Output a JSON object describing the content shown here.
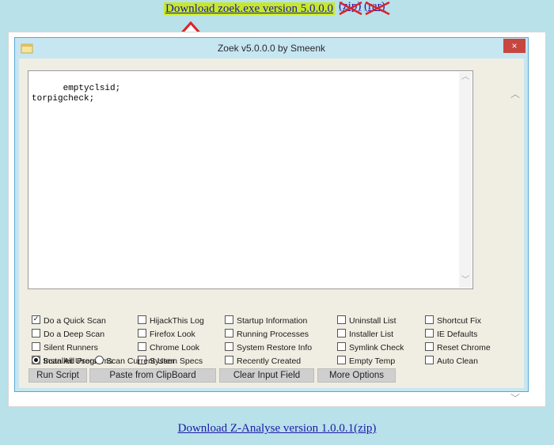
{
  "top_link": "Download zoek.exe version 5.0.0.0",
  "struck_links": [
    "(zip)",
    "(rar)"
  ],
  "bottom_link": "Download Z-Analyse version 1.0.0.1(zip)",
  "window": {
    "title": "Zoek v5.0.0.0 by Smeenk",
    "close_glyph": "×",
    "textarea_text": "emptyclsid;\ntorpigcheck;"
  },
  "checkboxes": {
    "col1": [
      {
        "label": "Do a Quick Scan",
        "checked": true
      },
      {
        "label": "Do a Deep Scan",
        "checked": false
      },
      {
        "label": "Silent Runners",
        "checked": false
      },
      {
        "label": "Installed Programs",
        "checked": false
      }
    ],
    "col2": [
      {
        "label": "HijackThis Log",
        "checked": false
      },
      {
        "label": "Firefox Look",
        "checked": false
      },
      {
        "label": "Chrome Look",
        "checked": false
      },
      {
        "label": "System Specs",
        "checked": false
      }
    ],
    "col3": [
      {
        "label": "Startup Information",
        "checked": false
      },
      {
        "label": "Running Processes",
        "checked": false
      },
      {
        "label": "System Restore Info",
        "checked": false
      },
      {
        "label": "Recently Created",
        "checked": false
      }
    ],
    "col4": [
      {
        "label": "Uninstall List",
        "checked": false
      },
      {
        "label": "Installer List",
        "checked": false
      },
      {
        "label": "Symlink Check",
        "checked": false
      },
      {
        "label": "Empty Temp",
        "checked": false
      }
    ],
    "col5": [
      {
        "label": "Shortcut Fix",
        "checked": false
      },
      {
        "label": "IE Defaults",
        "checked": false
      },
      {
        "label": "Reset Chrome",
        "checked": false
      },
      {
        "label": "Auto Clean",
        "checked": false
      }
    ]
  },
  "radios": [
    {
      "label": "Scan All Users",
      "selected": true
    },
    {
      "label": "Scan Current User",
      "selected": false
    }
  ],
  "buttons": {
    "run_script": "Run Script",
    "paste": "Paste from ClipBoard",
    "clear": "Clear Input Field",
    "more": "More Options"
  },
  "colors": {
    "highlight": "#c7e82a",
    "arrow": "#e0202a",
    "link": "#1a1aa6"
  }
}
